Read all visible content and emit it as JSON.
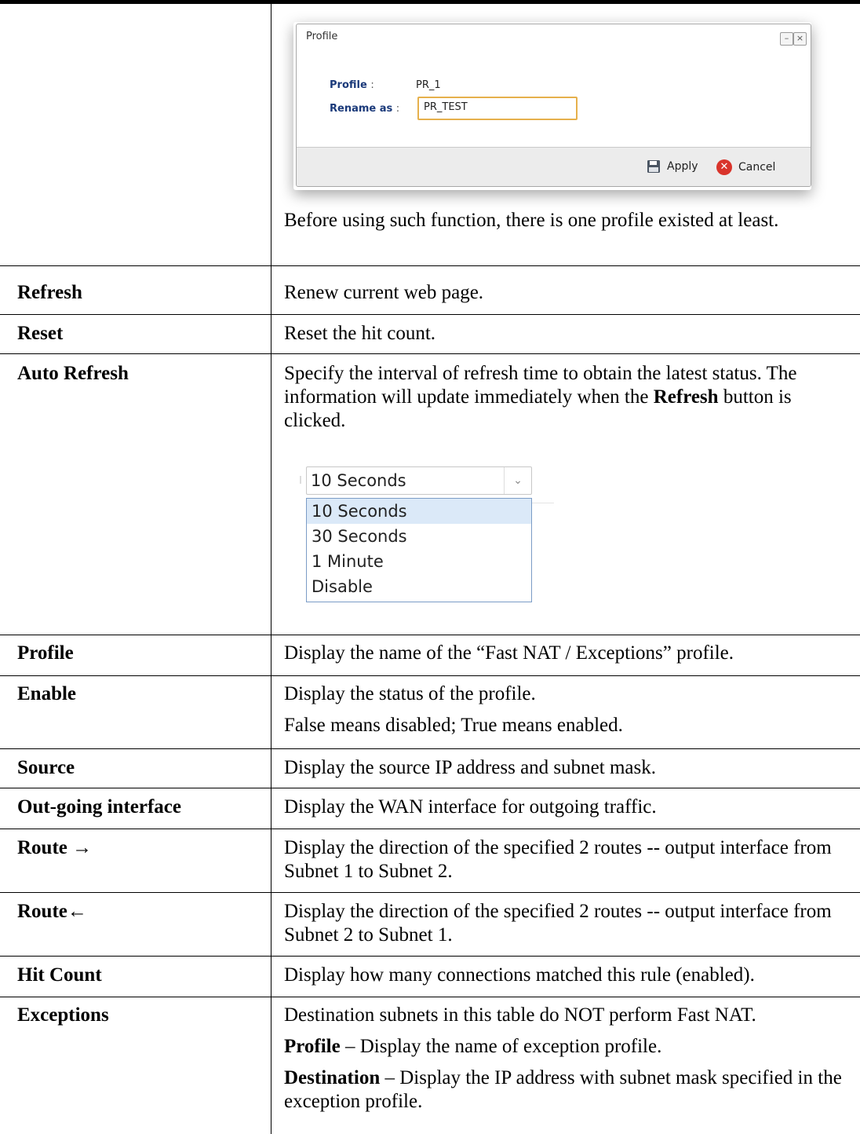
{
  "dialog": {
    "title": "Profile",
    "minimize_glyph": "–",
    "close_glyph": "×",
    "profile_label": "Profile",
    "profile_value": "PR_1",
    "rename_label": "Rename as",
    "rename_value": "PR_TEST",
    "separator": ":",
    "apply_label": "Apply",
    "cancel_label": "Cancel"
  },
  "intro_note": "Before using such function, there is one profile existed at least.",
  "auto_refresh_dropdown": {
    "selected": "10 Seconds",
    "options": [
      "10 Seconds",
      "30 Seconds",
      "1 Minute",
      "Disable"
    ]
  },
  "rows": {
    "refresh": {
      "term": "Refresh",
      "desc": "Renew current web page."
    },
    "reset": {
      "term": "Reset",
      "desc": "Reset the hit count."
    },
    "auto_refresh": {
      "term": "Auto Refresh",
      "desc_pre": "Specify the interval of refresh time to obtain the latest status. The information will update immediately when the ",
      "desc_bold": "Refresh",
      "desc_post": " button is clicked."
    },
    "profile": {
      "term": "Profile",
      "desc": "Display the name of the “Fast NAT / Exceptions” profile."
    },
    "enable": {
      "term": "Enable",
      "desc1": "Display the status of the profile.",
      "desc2": "False means disabled; True means enabled."
    },
    "source": {
      "term": "Source",
      "desc": "Display the source IP address and subnet mask."
    },
    "outgoing": {
      "term": "Out-going interface",
      "desc": "Display the WAN interface for outgoing traffic."
    },
    "route_fwd": {
      "term": "Route →",
      "desc": "Display the direction of the specified 2 routes -- output interface from Subnet 1 to Subnet 2."
    },
    "route_back": {
      "term": "Route←",
      "desc": "Display the direction of the specified 2 routes -- output interface from Subnet 2 to Subnet 1."
    },
    "hit_count": {
      "term": "Hit Count",
      "desc": "Display how many connections matched this rule (enabled)."
    },
    "exceptions": {
      "term": "Exceptions",
      "desc1": "Destination subnets in this table do NOT perform Fast NAT.",
      "profile_bold": "Profile",
      "profile_rest": " – Display the name of exception profile.",
      "dest_bold": "Destination",
      "dest_rest": " – Display the IP address with subnet mask specified in the exception profile."
    }
  }
}
